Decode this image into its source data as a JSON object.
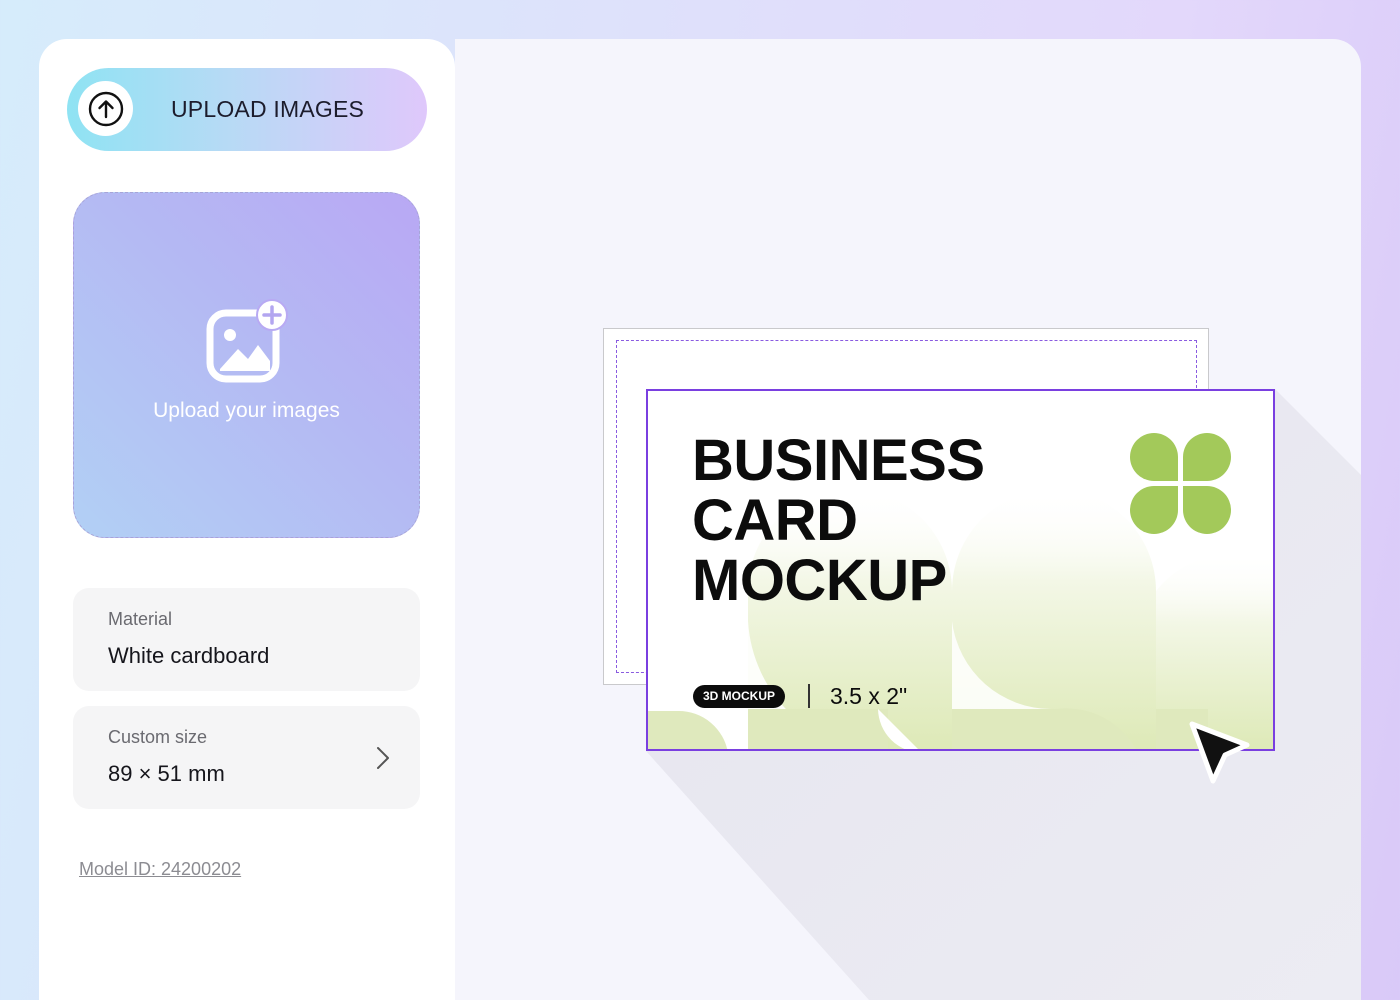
{
  "sidebar": {
    "upload_button_label": "UPLOAD IMAGES",
    "dropzone_text": "Upload your images",
    "material": {
      "label": "Material",
      "value": "White cardboard"
    },
    "custom_size": {
      "label": "Custom size",
      "value": "89 × 51 mm"
    },
    "model_id": "Model ID:  24200202"
  },
  "preview": {
    "card_title_line1": "BUSINESS",
    "card_title_line2": "CARD",
    "card_title_line3": "MOCKUP",
    "badge": "3D MOCKUP",
    "size": "3.5 x 2\""
  },
  "colors": {
    "accent_purple": "#7a3fe0",
    "clover_green": "#a3c95a",
    "card_gradient_green": "#dfe9bd"
  },
  "icons": [
    "arrow-up-circle-icon",
    "image-add-icon",
    "chevron-right-icon",
    "cursor-arrow-icon",
    "clover-logo-icon"
  ]
}
